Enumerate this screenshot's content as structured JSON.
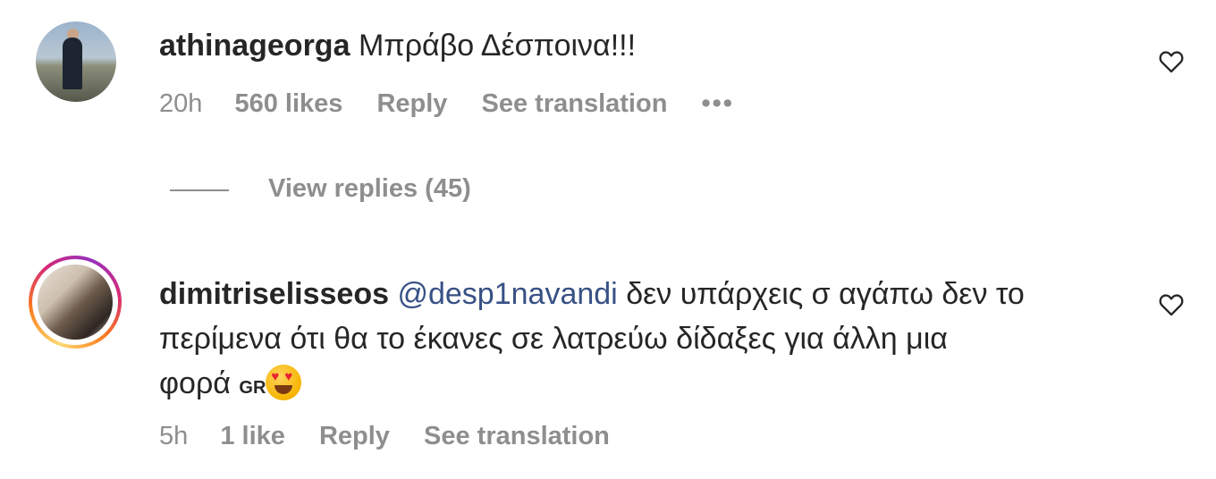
{
  "comments": [
    {
      "username": "athinageorga",
      "text": "Μπράβο Δέσποινα!!!",
      "time": "20h",
      "likes": "560 likes",
      "reply": "Reply",
      "translation": "See translation",
      "more": "•••",
      "view_replies": "View replies (45)"
    },
    {
      "username": "dimitriselisseos",
      "mention": "@desp1navandi",
      "line1": "δεν υπάρχεις σ αγάπω δεν το",
      "line2": "περίμενα ότι θα το έκανες σε λατρεύω δίδαξες για άλλη μια",
      "line3": "φορά",
      "flag": "GR",
      "time": "5h",
      "likes": "1 like",
      "reply": "Reply",
      "translation": "See translation"
    }
  ],
  "icons": {
    "like": "heart-outline-icon",
    "emoji": "heart-eyes-emoji-icon",
    "more": "more-options-icon"
  }
}
